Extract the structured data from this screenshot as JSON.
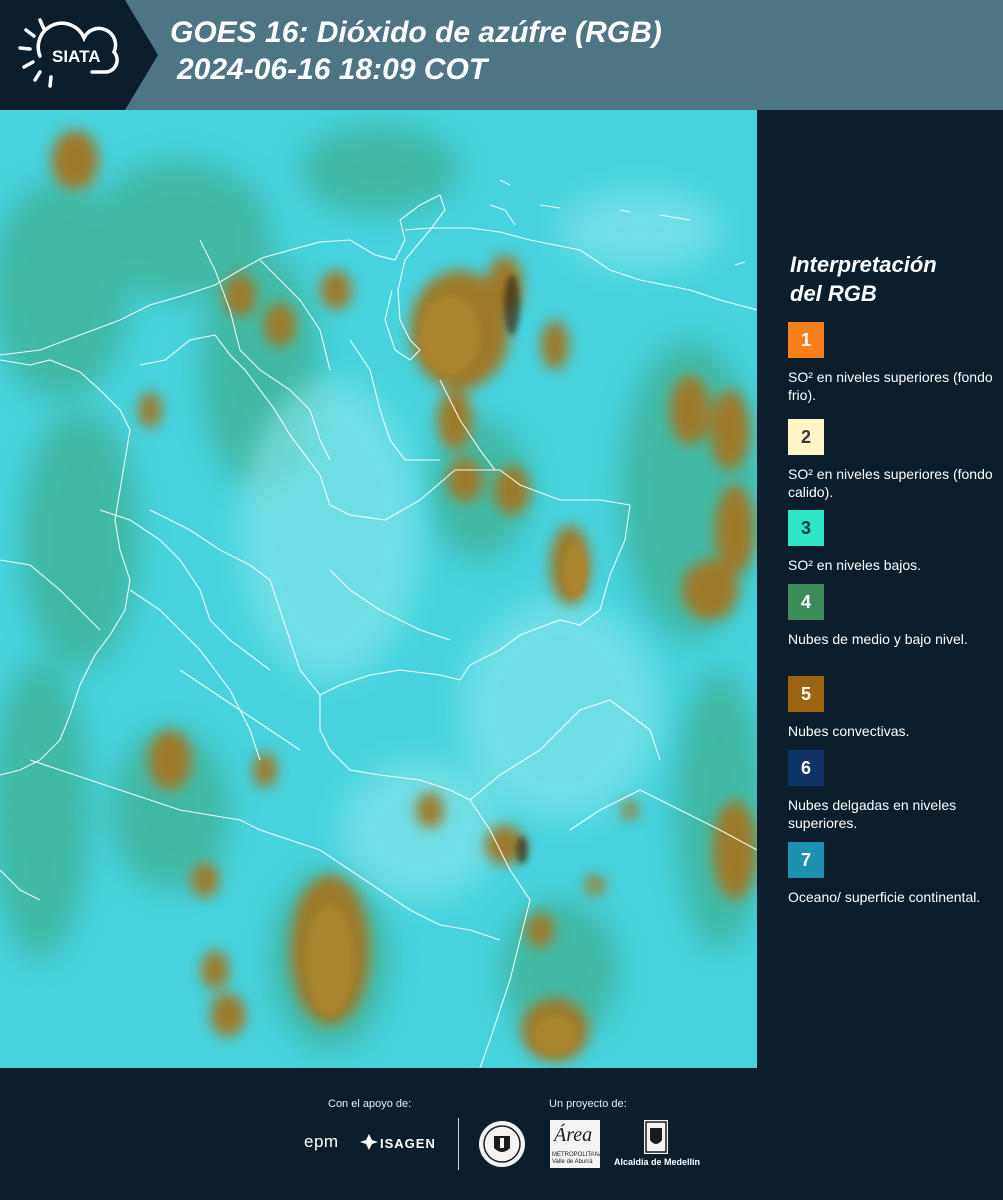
{
  "header": {
    "logo_text": "SIATA",
    "title_line1": "GOES 16: Dióxido de azúfre (RGB)",
    "title_line2": "2024-06-16 18:09 COT"
  },
  "legend": {
    "title_line1": "Interpretación",
    "title_line2": "del RGB",
    "items": [
      {
        "number": "1",
        "color": "#f7801c",
        "label": "SO² en niveles superiores (fondo frio)."
      },
      {
        "number": "2",
        "color": "#fff5c8",
        "label": "SO² en niveles superiores (fondo calido)."
      },
      {
        "number": "3",
        "color": "#2ee6c6",
        "label": "SO² en niveles bajos."
      },
      {
        "number": "4",
        "color": "#3c8c5a",
        "label": "Nubes de medio y bajo nivel."
      },
      {
        "number": "5",
        "color": "#9c6410",
        "label": "Nubes convectivas."
      },
      {
        "number": "6",
        "color": "#0e3366",
        "label": "Nubes delgadas en niveles superiores."
      },
      {
        "number": "7",
        "color": "#1e90b0",
        "label": "Oceano/ superficie continental."
      }
    ]
  },
  "footer": {
    "support_label": "Con el apoyo de:",
    "project_label": "Un proyecto de:",
    "epm_text": "epm",
    "isagen_text": "ISAGEN",
    "area_text": "Área",
    "area_subtext": "METROPOLITANA Valle de Aburrá",
    "alcaldia_text": "Alcaldía de Medellín"
  },
  "colors": {
    "header_bg": "#4e7583",
    "panel_bg": "#0c1e2b",
    "clear_sky": "#45d4e0",
    "convective": "#9c7a2a",
    "low_cloud": "#3c8c5a"
  }
}
